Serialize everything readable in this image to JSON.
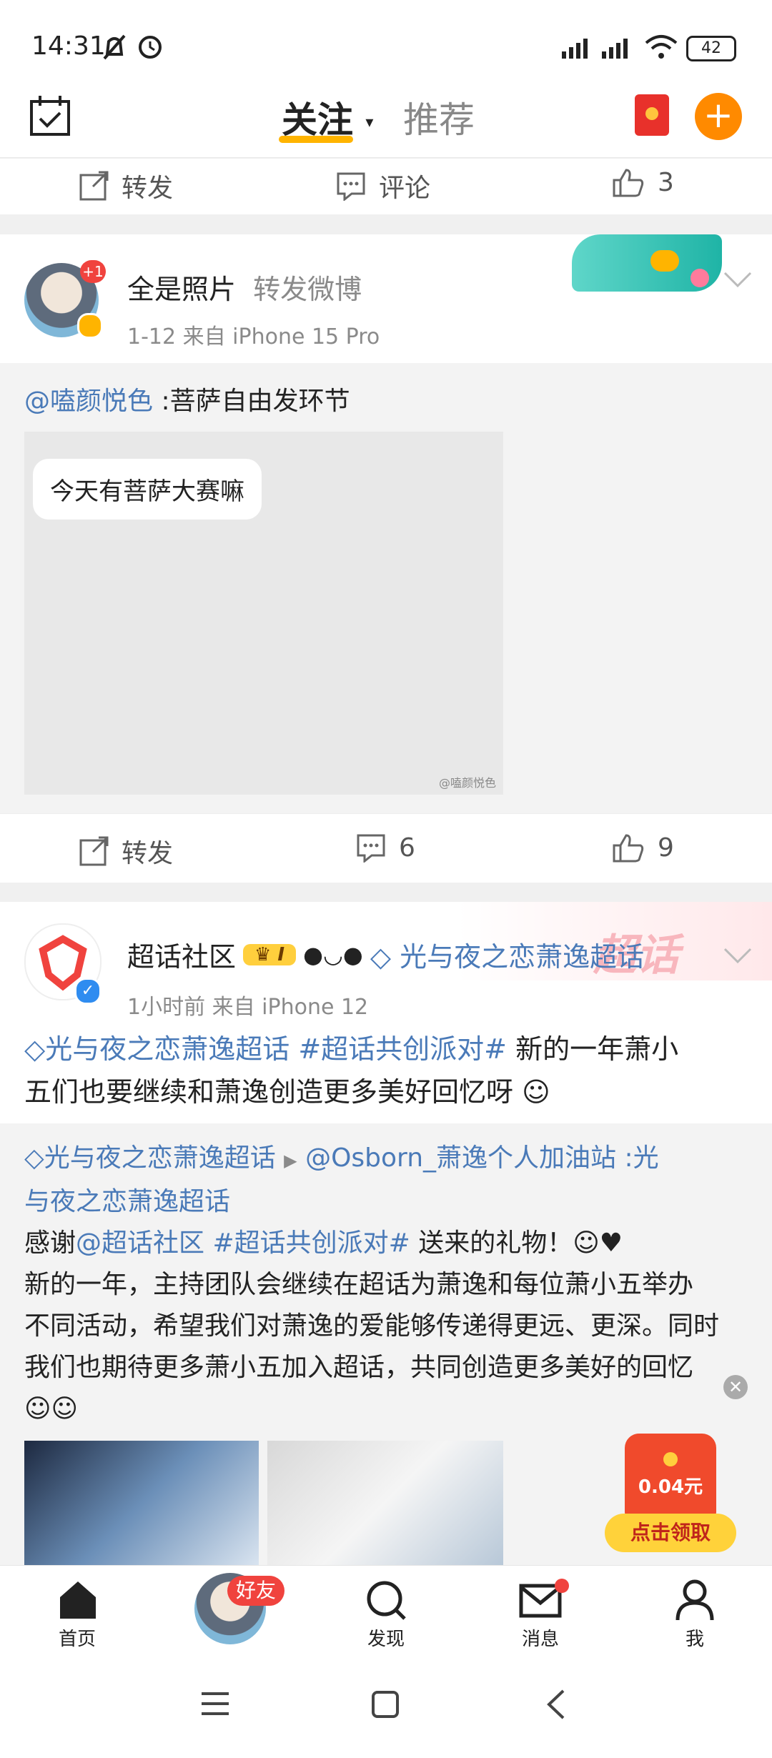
{
  "status": {
    "time": "14:31",
    "battery": "42"
  },
  "topnav": {
    "tab_follow": "关注",
    "tab_recommend": "推荐"
  },
  "post0": {
    "repost": "转发",
    "comment": "评论",
    "likes": "3"
  },
  "post1": {
    "author": "全是照片",
    "action": "转发微博",
    "meta": "1-12 来自 iPhone 15 Pro",
    "avatar_badge": "+1",
    "quote_user": "@嗑颜悦色",
    "quote_text": " :菩萨自由发环节",
    "image_caption": "今天有菩萨大赛嘛",
    "watermark": "@嗑颜悦色",
    "repost": "转发",
    "comments": "6",
    "likes": "9"
  },
  "post2": {
    "author": "超话社区",
    "level": "I",
    "topic": "光与夜之恋萧逸超话",
    "meta": "1小时前 来自 iPhone 12",
    "text_topic": "光与夜之恋萧逸超话",
    "text_tag": "#超话共创派对#",
    "text_body1": " 新的一年萧小",
    "text_body2": "五们也要继续和萧逸创造更多美好回忆呀",
    "repost_topic": "光与夜之恋萧逸超话",
    "repost_user": "@Osborn_萧逸个人加油站",
    "repost_topic2a": " :光",
    "repost_topic2b": "与夜之恋萧逸超话",
    "line1_a": "感谢",
    "line1_user": "@超话社区",
    "line1_tag": " #超话共创派对#",
    "line1_b": " 送来的礼物！",
    "para1": "新的一年，主持团队会继续在超话为萧逸和每位萧小五举办",
    "para2": "不同活动，希望我们对萧逸的爱能够传递得更远、更深。同时",
    "para3": "我们也期待更多萧小五加入超话，共同创造更多美好的回忆",
    "super_label": "超话"
  },
  "redpacket": {
    "amount": "0.04元",
    "button": "点击领取"
  },
  "bottomnav": {
    "home": "首页",
    "friends": "好友",
    "discover": "发现",
    "messages": "消息",
    "me": "我"
  }
}
